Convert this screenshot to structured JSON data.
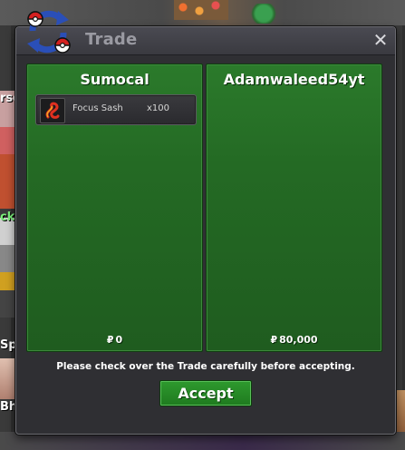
{
  "window": {
    "title": "Trade",
    "close_label": "✕"
  },
  "background": {
    "labels": [
      "rse",
      "ck",
      "Sp",
      "Bh"
    ]
  },
  "left_panel": {
    "player_name": "Sumocal",
    "items": [
      {
        "name": "Focus Sash",
        "quantity": "x100",
        "icon": "focus-sash-icon"
      }
    ],
    "currency_symbol": "₽",
    "money": "0"
  },
  "right_panel": {
    "player_name": "Adamwaleed54yt",
    "items": [],
    "currency_symbol": "₽",
    "money": "80,000"
  },
  "footer": {
    "notice": "Please check over the Trade carefully before accepting.",
    "accept_label": "Accept"
  },
  "colors": {
    "panel_green": "#246a24",
    "accept_green": "#2e9a2e",
    "window_bg": "#2f2f33",
    "title_text": "#9a9aa2"
  }
}
